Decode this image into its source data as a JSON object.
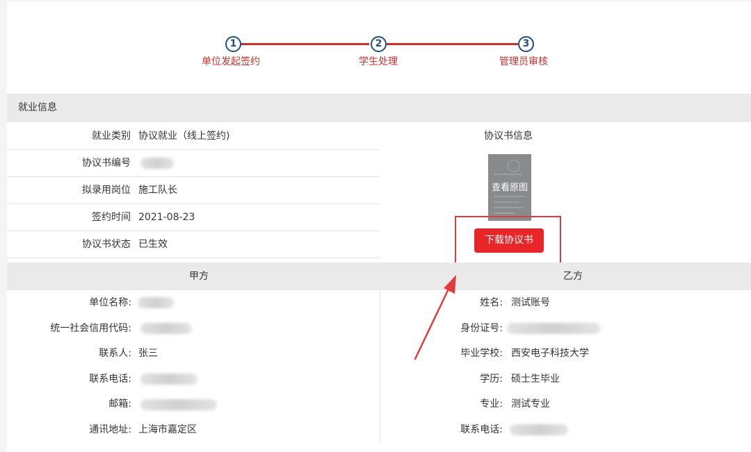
{
  "stepper": {
    "steps": [
      {
        "number": "1",
        "label": "单位发起签约"
      },
      {
        "number": "2",
        "label": "学生处理"
      },
      {
        "number": "3",
        "label": "管理员审核"
      }
    ]
  },
  "section": {
    "title": "就业信息"
  },
  "employment_info": {
    "rows": [
      {
        "label": "就业类别",
        "value": "协议就业（线上签约)"
      },
      {
        "label": "协议书编号",
        "value": ""
      },
      {
        "label": "拟录用岗位",
        "value": "施工队长"
      },
      {
        "label": "签约时间",
        "value": "2021-08-23"
      },
      {
        "label": "协议书状态",
        "value": "已生效"
      }
    ]
  },
  "agreement": {
    "title": "协议书信息",
    "thumbnail_label": "查看原图",
    "download_label": "下载协议书"
  },
  "party_a": {
    "title": "甲方",
    "rows": [
      {
        "label": "单位名称:",
        "value": ""
      },
      {
        "label": "统一社会信用代码:",
        "value": ""
      },
      {
        "label": "联系人:",
        "value": "张三"
      },
      {
        "label": "联系电话:",
        "value": ""
      },
      {
        "label": "邮箱:",
        "value": ""
      },
      {
        "label": "通讯地址:",
        "value": "上海市嘉定区"
      }
    ]
  },
  "party_b": {
    "title": "乙方",
    "rows": [
      {
        "label": "姓名:",
        "value": "测试账号"
      },
      {
        "label": "身份证号:",
        "value": ""
      },
      {
        "label": "毕业学校:",
        "value": "西安电子科技大学"
      },
      {
        "label": "学历:",
        "value": "硕士生毕业"
      },
      {
        "label": "专业:",
        "value": "测试专业"
      },
      {
        "label": "联系电话:",
        "value": ""
      }
    ]
  },
  "colors": {
    "accent_red": "#e8262a",
    "step_blue": "#1f4e8c",
    "step_line_red": "#c9302c",
    "header_gray": "#eaeaea"
  }
}
